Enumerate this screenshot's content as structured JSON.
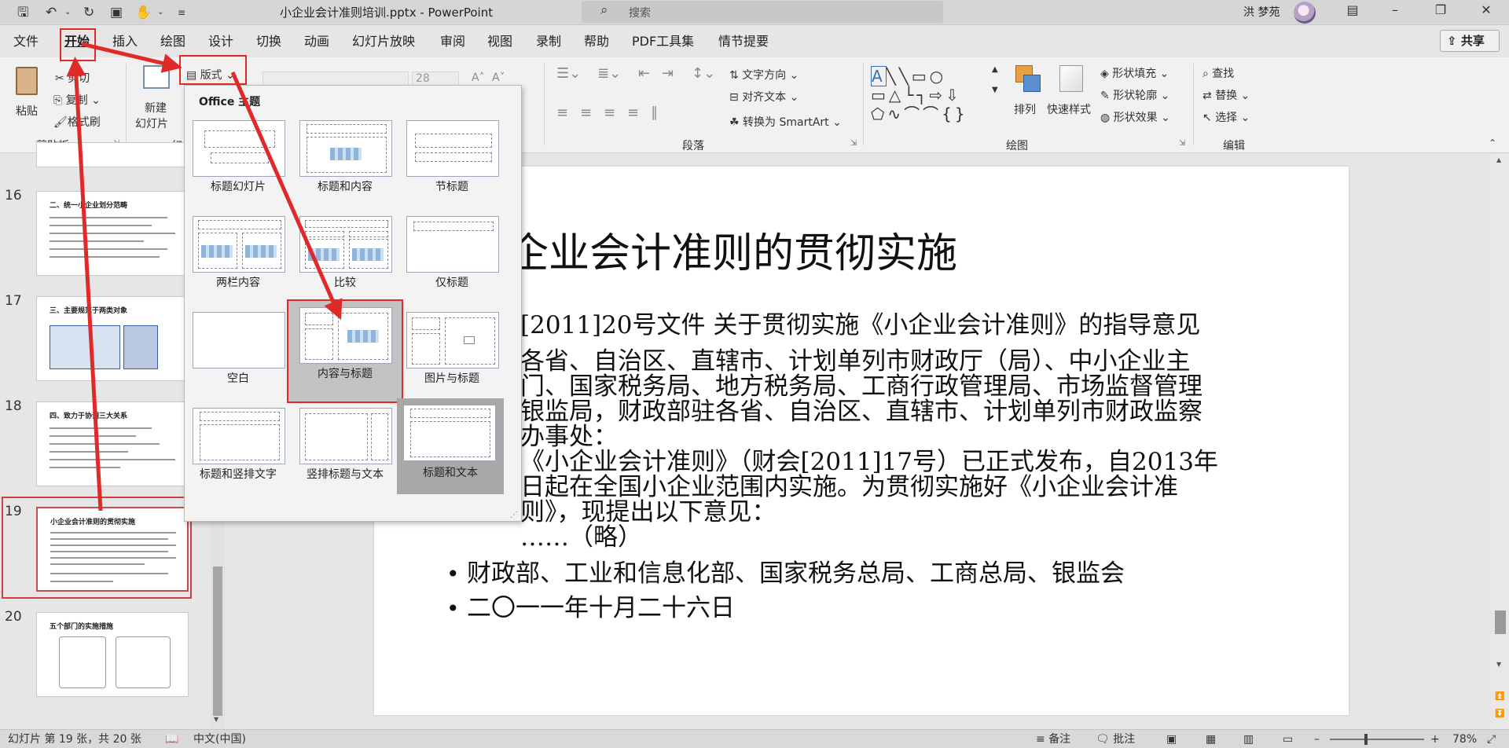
{
  "window": {
    "doc_title": "小企业会计准则培训.pptx  -  PowerPoint",
    "search_placeholder": "搜索",
    "user_name": "洪 梦苑"
  },
  "quick_access": [
    "save-icon",
    "undo-icon",
    "redo-icon",
    "present-icon",
    "touch-mode-icon",
    "customize-icon"
  ],
  "tabs": [
    {
      "label": "文件"
    },
    {
      "label": "开始",
      "active": true
    },
    {
      "label": "插入"
    },
    {
      "label": "绘图"
    },
    {
      "label": "设计"
    },
    {
      "label": "切换"
    },
    {
      "label": "动画"
    },
    {
      "label": "幻灯片放映"
    },
    {
      "label": "审阅"
    },
    {
      "label": "视图"
    },
    {
      "label": "录制"
    },
    {
      "label": "帮助"
    },
    {
      "label": "PDF工具集"
    },
    {
      "label": "情节提要"
    }
  ],
  "share_label": "共享",
  "ribbon": {
    "clipboard": {
      "paste": "粘贴",
      "cut": "剪切",
      "copy": "复制",
      "format_painter": "格式刷",
      "group": "剪贴板"
    },
    "slides": {
      "new_slide_1": "新建",
      "new_slide_2": "幻灯片",
      "layout": "版式",
      "group": "幻"
    },
    "font": {
      "size": "28"
    },
    "paragraph": {
      "text_direction": "文字方向",
      "align_text": "对齐文本",
      "smartart": "转换为 SmartArt",
      "group": "段落"
    },
    "drawing": {
      "arrange": "排列",
      "quick_styles": "快速样式",
      "fill": "形状填充",
      "outline": "形状轮廓",
      "effects": "形状效果",
      "group": "绘图"
    },
    "editing": {
      "find": "查找",
      "replace": "替换",
      "select": "选择",
      "group": "编辑"
    }
  },
  "thumbnails": [
    {
      "num": "16",
      "title": "二、统一小企业划分范畴"
    },
    {
      "num": "17",
      "title": "三、主要规范于两类对象"
    },
    {
      "num": "18",
      "title": "四、致力于协调三大关系"
    },
    {
      "num": "19",
      "title": "小企业会计准则的贯彻实施",
      "selected": true
    },
    {
      "num": "20",
      "title": "五个部门的实施措施"
    }
  ],
  "layout_gallery": {
    "header": "Office 主题",
    "items": [
      {
        "label": "标题幻灯片"
      },
      {
        "label": "标题和内容"
      },
      {
        "label": "节标题"
      },
      {
        "label": "两栏内容"
      },
      {
        "label": "比较"
      },
      {
        "label": "仅标题"
      },
      {
        "label": "空白"
      },
      {
        "label": "内容与标题",
        "highlighted": true
      },
      {
        "label": "图片与标题"
      },
      {
        "label": "标题和竖排文字"
      },
      {
        "label": "竖排标题与文本"
      },
      {
        "label": "标题和文本",
        "selected": true
      }
    ]
  },
  "slide": {
    "title": "企业会计准则的贯彻实施",
    "lines": [
      "[2011]20号文件      关于贯彻实施《小企业会计准则》的指导意见",
      "各省、自治区、直辖市、计划单列市财政厅（局）、中小企业主",
      "门、国家税务局、地方税务局、工商行政管理局、市场监督管理",
      "银监局，财政部驻各省、自治区、直辖市、计划单列市财政监察",
      "办事处：",
      "《小企业会计准则》（财会[2011]17号）已正式发布，自2013年",
      "日起在全国小企业范围内实施。为贯彻实施好《小企业会计准",
      "则》，现提出以下意见：",
      "……（略）"
    ],
    "bullets": [
      "财政部、工业和信息化部、国家税务总局、工商总局、银监会",
      "二〇一一年十月二十六日"
    ]
  },
  "status": {
    "slide_info": "幻灯片 第 19 张，共 20 张",
    "language": "中文(中国)",
    "notes": "备注",
    "comments": "批注",
    "zoom": "78%"
  },
  "annotation_color": "#e02a2a"
}
